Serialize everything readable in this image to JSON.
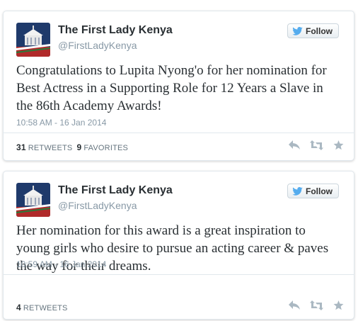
{
  "colors": {
    "twitter_blue": "#55acee",
    "avatar_bg": "#1f3a6b",
    "action_gray": "#aab8c2"
  },
  "tweets": [
    {
      "name": "The First Lady Kenya",
      "handle": "@FirstLadyKenya",
      "follow_label": "Follow",
      "text": "Congratulations to Lupita Nyong'o for her nomination for Best Actress in a Supporting Role for 12 Years a Slave in the 86th Academy Awards!",
      "timestamp": "10:58 AM - 16 Jan 2014",
      "retweets_count": "31",
      "retweets_label": "RETWEETS",
      "favorites_count": "9",
      "favorites_label": "FAVORITES"
    },
    {
      "name": "The First Lady Kenya",
      "handle": "@FirstLadyKenya",
      "follow_label": "Follow",
      "text": "Her nomination for this award is a great inspiration to young girls who desire to pursue an acting career & paves the way for their dreams.",
      "timestamp": "10:59 AM - 16 Jan 2014",
      "retweets_count": "4",
      "retweets_label": "RETWEETS"
    }
  ],
  "icons": {
    "follow": "twitter-bird-icon",
    "reply": "reply-icon",
    "retweet": "retweet-icon",
    "favorite": "star-icon"
  }
}
